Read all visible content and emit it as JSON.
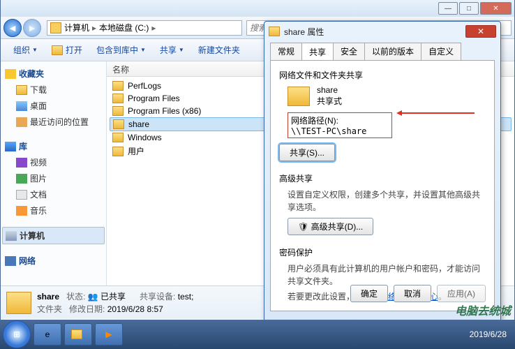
{
  "explorer": {
    "breadcrumb": {
      "root": "计算机",
      "drive": "本地磁盘 (C:)"
    },
    "search_placeholder": "搜索 本地磁盘 (C:)",
    "toolbar": {
      "org": "组织",
      "open": "打开",
      "include": "包含到库中",
      "share": "共享",
      "newfolder": "新建文件夹"
    },
    "col_name": "名称",
    "sidebar": {
      "fav": "收藏夹",
      "downloads": "下载",
      "desktop": "桌面",
      "recent": "最近访问的位置",
      "lib": "库",
      "video": "视频",
      "pic": "图片",
      "doc": "文档",
      "music": "音乐",
      "computer": "计算机",
      "network": "网络"
    },
    "files": [
      "PerfLogs",
      "Program Files",
      "Program Files (x86)",
      "share",
      "Windows",
      "用户"
    ],
    "selected_index": 3,
    "status": {
      "name": "share",
      "state_label": "状态:",
      "state_val": "已共享",
      "date_label": "修改日期:",
      "date_val": "2019/6/28 8:57",
      "dev_label": "共享设备:",
      "dev_val": "test;",
      "type": "文件夹"
    }
  },
  "props": {
    "title": "share 属性",
    "tabs": [
      "常规",
      "共享",
      "安全",
      "以前的版本",
      "自定义"
    ],
    "active_tab": 1,
    "s1_head": "网络文件和文件夹共享",
    "folder_name": "share",
    "share_state": "共享式",
    "path_label": "网络路径(N):",
    "path_value": "\\\\TEST-PC\\share",
    "share_btn": "共享(S)...",
    "s2_head": "高级共享",
    "s2_desc": "设置自定义权限，创建多个共享，并设置其他高级共享选项。",
    "adv_btn": "高级共享(D)...",
    "s3_head": "密码保护",
    "s3_desc1": "用户必须具有此计算机的用户帐户和密码，才能访问共享文件夹。",
    "s3_desc2a": "若要更改此设置，请使用",
    "s3_link": "网络和共享中心",
    "ok": "确定",
    "cancel": "取消",
    "apply": "应用(A)"
  },
  "tray": {
    "date": "2019/6/28"
  },
  "watermark": "电脑去统城"
}
